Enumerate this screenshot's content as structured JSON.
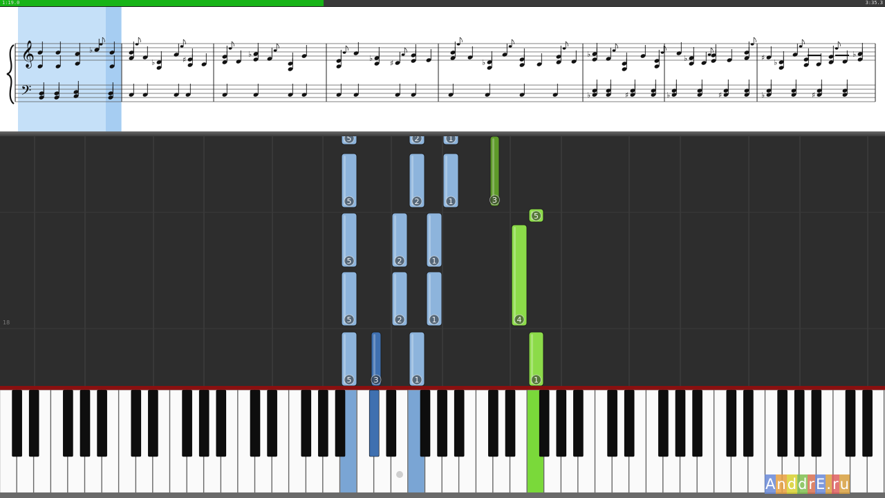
{
  "playback": {
    "elapsed": "1:19.0",
    "total": "3:35.3",
    "progress_fraction": 0.366
  },
  "sheet_music": {
    "measures_visible": 8,
    "current_beat_highlighted": true,
    "colors": {
      "highlight": "#c5e0f8",
      "highlight_strong": "#a6cdf2"
    }
  },
  "falling_notes": {
    "measure_marker": "18",
    "colors": {
      "left_hand": "#8db4dc",
      "left_hand_active": "#3f70b0",
      "right_hand": "#8cdb49",
      "right_hand_dim": "#5e9a2a"
    },
    "notes": [
      {
        "finger": "5",
        "hand": "left"
      },
      {
        "finger": "5",
        "hand": "left"
      },
      {
        "finger": "5",
        "hand": "left"
      },
      {
        "finger": "5",
        "hand": "left"
      },
      {
        "finger": "5",
        "hand": "left"
      },
      {
        "finger": "3",
        "hand": "left"
      },
      {
        "finger": "2",
        "hand": "left"
      },
      {
        "finger": "2",
        "hand": "left"
      },
      {
        "finger": "2",
        "hand": "left"
      },
      {
        "finger": "2",
        "hand": "left"
      },
      {
        "finger": "1",
        "hand": "left"
      },
      {
        "finger": "1",
        "hand": "left"
      },
      {
        "finger": "1",
        "hand": "left"
      },
      {
        "finger": "1",
        "hand": "left"
      },
      {
        "finger": "1",
        "hand": "left"
      },
      {
        "finger": "3",
        "hand": "right"
      },
      {
        "finger": "5",
        "hand": "right"
      },
      {
        "finger": "4",
        "hand": "right"
      },
      {
        "finger": "1",
        "hand": "right"
      }
    ]
  },
  "keyboard": {
    "pressed_keys": [
      "left-5",
      "left-3",
      "left-1",
      "right-1"
    ]
  },
  "watermark": {
    "letters": [
      "A",
      "n",
      "d",
      "d",
      "r",
      "E",
      ".",
      "r",
      "u"
    ],
    "colors": [
      "#6a8ad8",
      "#e8a040",
      "#d8d030",
      "#80c050",
      "#d87050",
      "#6a8ad8",
      "#d8a040",
      "#e06060",
      "#d8a040"
    ]
  }
}
